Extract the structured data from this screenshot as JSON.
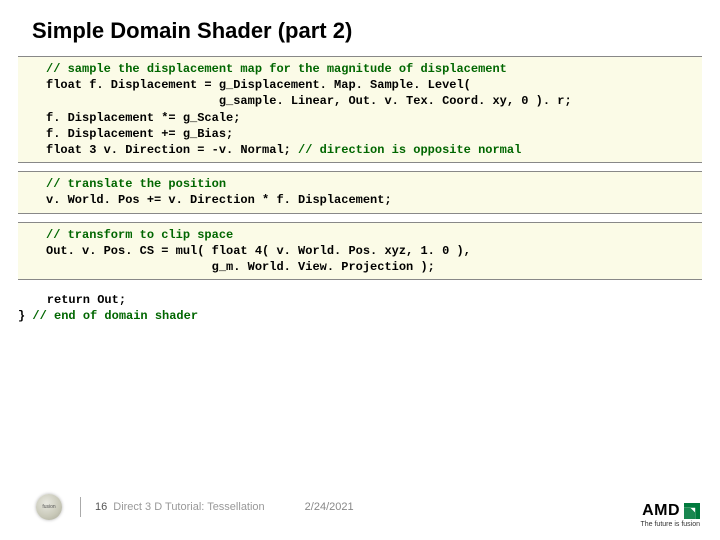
{
  "title": "Simple Domain Shader (part 2)",
  "code": {
    "block1": {
      "l1": "// sample the displacement map for the magnitude of displacement",
      "l2": "float f. Displacement = g_Displacement. Map. Sample. Level(",
      "l3": "                        g_sample. Linear, Out. v. Tex. Coord. xy, 0 ). r;",
      "l4": "f. Displacement *= g_Scale;",
      "l5": "f. Displacement += g_Bias;",
      "l6a": "float 3 v. Direction = -v. Normal; ",
      "l6b": "// direction is opposite normal"
    },
    "block2": {
      "l1": "// translate the position",
      "l2": "v. World. Pos += v. Direction * f. Displacement;"
    },
    "block3": {
      "l1": "// transform to clip space",
      "l2": "Out. v. Pos. CS = mul( float 4( v. World. Pos. xyz, 1. 0 ),",
      "l3": "                       g_m. World. View. Projection );"
    },
    "tail": {
      "l1": "    return Out;",
      "l2a": "} ",
      "l2b": "// end of domain shader"
    }
  },
  "footer": {
    "badge": "fusion",
    "page": "16",
    "doc": "Direct 3 D Tutorial: Tessellation",
    "date": "2/24/2021"
  },
  "brand": {
    "name": "AMD",
    "tagline": "The future is fusion"
  }
}
